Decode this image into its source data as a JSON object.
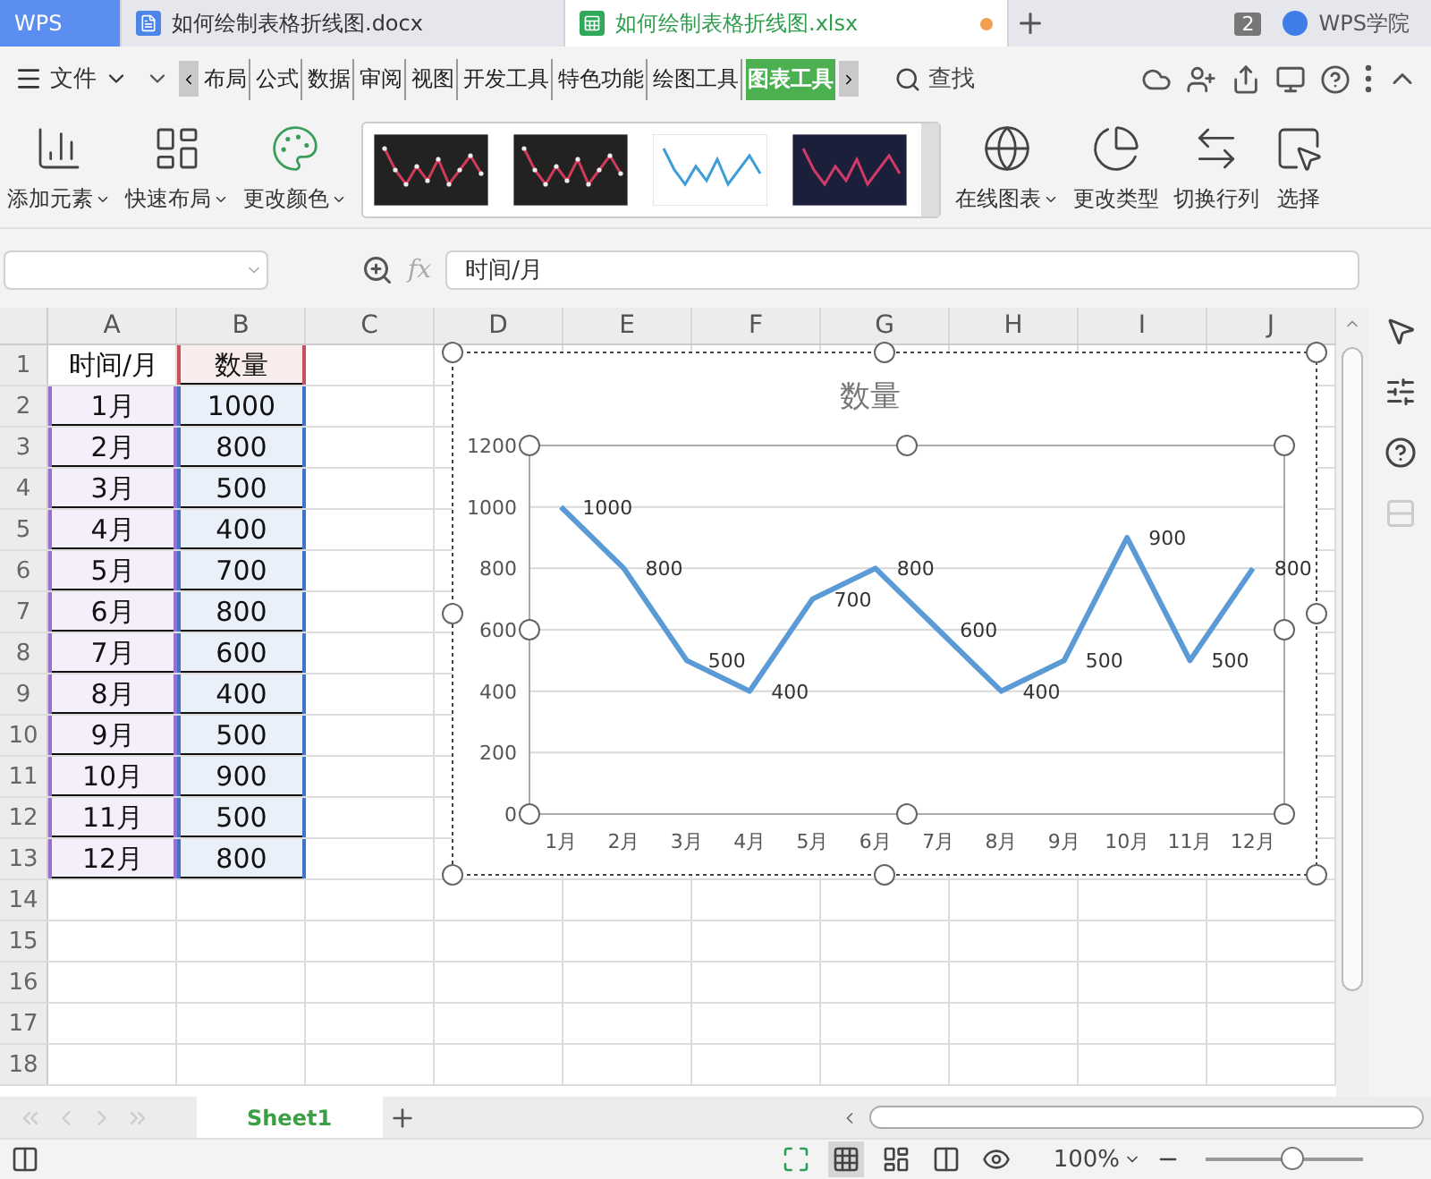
{
  "title_tabs": [
    {
      "kind": "home",
      "label": "WPS"
    },
    {
      "kind": "doc",
      "label": "如何绘制表格折线图.docx",
      "selected": false,
      "modified": false
    },
    {
      "kind": "sheet",
      "label": "如何绘制表格折线图.xlsx",
      "selected": true,
      "modified": true
    }
  ],
  "window_count": "2",
  "academy": "WPS学院",
  "file_menu": "文件",
  "menu_tabs": [
    {
      "label": "布局",
      "selected": false
    },
    {
      "label": "公式",
      "selected": false
    },
    {
      "label": "数据",
      "selected": false
    },
    {
      "label": "审阅",
      "selected": false
    },
    {
      "label": "视图",
      "selected": false
    },
    {
      "label": "开发工具",
      "selected": false
    },
    {
      "label": "特色功能",
      "selected": false
    },
    {
      "label": "绘图工具",
      "selected": false
    },
    {
      "label": "图表工具",
      "selected": true
    }
  ],
  "search": "查找",
  "ribbon_left": [
    {
      "kind": "add",
      "label": "添加元素",
      "dropdown": true
    },
    {
      "kind": "layout",
      "label": "快速布局",
      "dropdown": true
    },
    {
      "kind": "color",
      "label": "更改颜色",
      "dropdown": true
    }
  ],
  "chart_styles": [
    {
      "kind": "dark-dots"
    },
    {
      "kind": "dark-dots"
    },
    {
      "kind": "light"
    },
    {
      "kind": "navy"
    }
  ],
  "ribbon_right": [
    {
      "kind": "online",
      "label": "在线图表",
      "dropdown": true
    },
    {
      "kind": "type",
      "label": "更改类型",
      "dropdown": false
    },
    {
      "kind": "switch",
      "label": "切换行列",
      "dropdown": false
    },
    {
      "kind": "select",
      "label": "选择",
      "dropdown": false
    }
  ],
  "formula_bar": {
    "fx_label": "fx",
    "formula": "时间/月"
  },
  "columns": [
    "A",
    "B",
    "C",
    "D",
    "E",
    "F",
    "G",
    "H",
    "I",
    "J"
  ],
  "rows": [
    {
      "number": "1",
      "cells": [
        {
          "text": "时间/月"
        },
        {
          "text": "数量",
          "color": "#c9505a"
        }
      ]
    },
    {
      "number": "2",
      "cells": [
        {
          "text": "1月",
          "color": "#9b6fcf"
        },
        {
          "text": "1000",
          "color": "#4472c4"
        }
      ]
    },
    {
      "number": "3",
      "cells": [
        {
          "text": "2月",
          "color": "#9b6fcf"
        },
        {
          "text": "800",
          "color": "#4472c4"
        }
      ]
    },
    {
      "number": "4",
      "cells": [
        {
          "text": "3月",
          "color": "#9b6fcf"
        },
        {
          "text": "500",
          "color": "#4472c4"
        }
      ]
    },
    {
      "number": "5",
      "cells": [
        {
          "text": "4月",
          "color": "#9b6fcf"
        },
        {
          "text": "400",
          "color": "#4472c4"
        }
      ]
    },
    {
      "number": "6",
      "cells": [
        {
          "text": "5月",
          "color": "#9b6fcf"
        },
        {
          "text": "700",
          "color": "#4472c4"
        }
      ]
    },
    {
      "number": "7",
      "cells": [
        {
          "text": "6月",
          "color": "#9b6fcf"
        },
        {
          "text": "800",
          "color": "#4472c4"
        }
      ]
    },
    {
      "number": "8",
      "cells": [
        {
          "text": "7月",
          "color": "#9b6fcf"
        },
        {
          "text": "600",
          "color": "#4472c4"
        }
      ]
    },
    {
      "number": "9",
      "cells": [
        {
          "text": "8月",
          "color": "#9b6fcf"
        },
        {
          "text": "400",
          "color": "#4472c4"
        }
      ]
    },
    {
      "number": "10",
      "cells": [
        {
          "text": "9月",
          "color": "#9b6fcf"
        },
        {
          "text": "500",
          "color": "#4472c4"
        }
      ]
    },
    {
      "number": "11",
      "cells": [
        {
          "text": "10月",
          "color": "#9b6fcf"
        },
        {
          "text": "900",
          "color": "#4472c4"
        }
      ]
    },
    {
      "number": "12",
      "cells": [
        {
          "text": "11月",
          "color": "#9b6fcf"
        },
        {
          "text": "500",
          "color": "#4472c4"
        }
      ]
    },
    {
      "number": "13",
      "cells": [
        {
          "text": "12月",
          "color": "#9b6fcf"
        },
        {
          "text": "800",
          "color": "#4472c4"
        }
      ]
    },
    {
      "number": "14",
      "cells": []
    },
    {
      "number": "15",
      "cells": []
    },
    {
      "number": "16",
      "cells": []
    },
    {
      "number": "17",
      "cells": []
    },
    {
      "number": "18",
      "cells": []
    }
  ],
  "chart": {
    "selected": true,
    "chart_data": {
      "type": "line",
      "title": "数量",
      "categories": [
        "1月",
        "2月",
        "3月",
        "4月",
        "5月",
        "6月",
        "7月",
        "8月",
        "9月",
        "10月",
        "11月",
        "12月"
      ],
      "series": [
        {
          "color": "#5b9bd5",
          "values": [
            1000,
            800,
            500,
            400,
            700,
            800,
            600,
            400,
            500,
            900,
            500,
            800
          ]
        }
      ],
      "ylim": [
        0,
        1200
      ],
      "yticks": [
        0,
        200,
        400,
        600,
        800,
        1000,
        1200
      ],
      "grid": true,
      "data_labels": true
    }
  },
  "sheet_tabs": [
    {
      "label": "Sheet1",
      "selected": true
    }
  ],
  "status_bar": {
    "zoom": "100%",
    "zoom_slider": {
      "level": 0.55
    }
  }
}
